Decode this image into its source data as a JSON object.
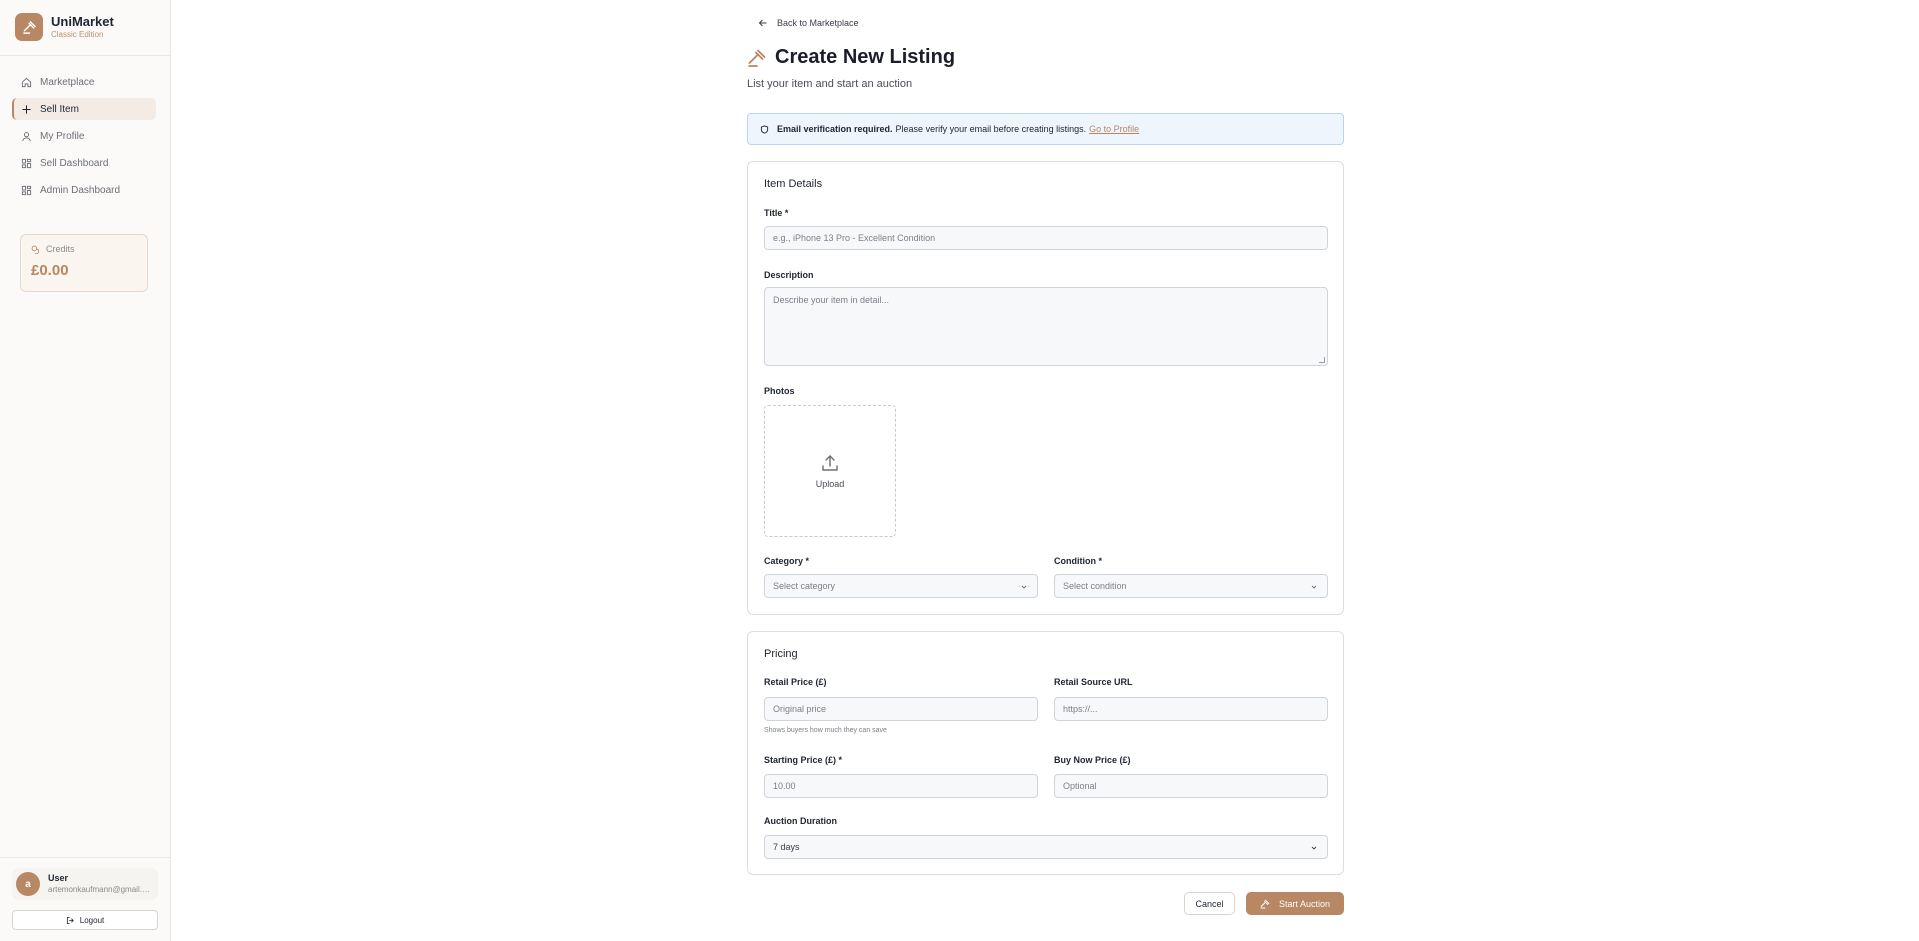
{
  "brand": {
    "name": "UniMarket",
    "edition": "Classic Edition"
  },
  "sidebar": {
    "items": [
      {
        "label": "Marketplace",
        "icon": "home-icon"
      },
      {
        "label": "Sell Item",
        "icon": "plus-icon",
        "active": true
      },
      {
        "label": "My Profile",
        "icon": "user-icon"
      },
      {
        "label": "Sell Dashboard",
        "icon": "dashboard-icon"
      },
      {
        "label": "Admin Dashboard",
        "icon": "dashboard-icon"
      }
    ],
    "credits": {
      "label": "Credits",
      "value": "£0.00"
    },
    "user": {
      "initial": "a",
      "name": "User",
      "email": "artemonkaufmann@gmail.c..."
    },
    "logout_label": "Logout"
  },
  "header": {
    "back_label": "Back to Marketplace",
    "title": "Create New Listing",
    "subtitle": "List your item and start an auction"
  },
  "alert": {
    "strong": "Email verification required.",
    "message": "Please verify your email before creating listings.",
    "link": "Go to Profile"
  },
  "item_details": {
    "title": "Item Details",
    "title_label": "Title *",
    "title_placeholder": "e.g., iPhone 13 Pro - Excellent Condition",
    "description_label": "Description",
    "description_placeholder": "Describe your item in detail...",
    "photos_label": "Photos",
    "upload_label": "Upload",
    "category_label": "Category *",
    "category_value": "Select category",
    "condition_label": "Condition *",
    "condition_value": "Select condition"
  },
  "pricing": {
    "title": "Pricing",
    "retail_price_label": "Retail Price (£)",
    "retail_price_placeholder": "Original price",
    "retail_price_hint": "Shows buyers how much they can save",
    "retail_url_label": "Retail Source URL",
    "retail_url_placeholder": "https://...",
    "starting_price_label": "Starting Price (£) *",
    "starting_price_value": "10.00",
    "buy_now_label": "Buy Now Price (£)",
    "buy_now_placeholder": "Optional",
    "duration_label": "Auction Duration",
    "duration_value": "7 days"
  },
  "actions": {
    "cancel": "Cancel",
    "start": "Start Auction"
  },
  "colors": {
    "accent": "#b88763",
    "alert_bg": "#eef5fd",
    "alert_border": "#b9d4ef"
  }
}
